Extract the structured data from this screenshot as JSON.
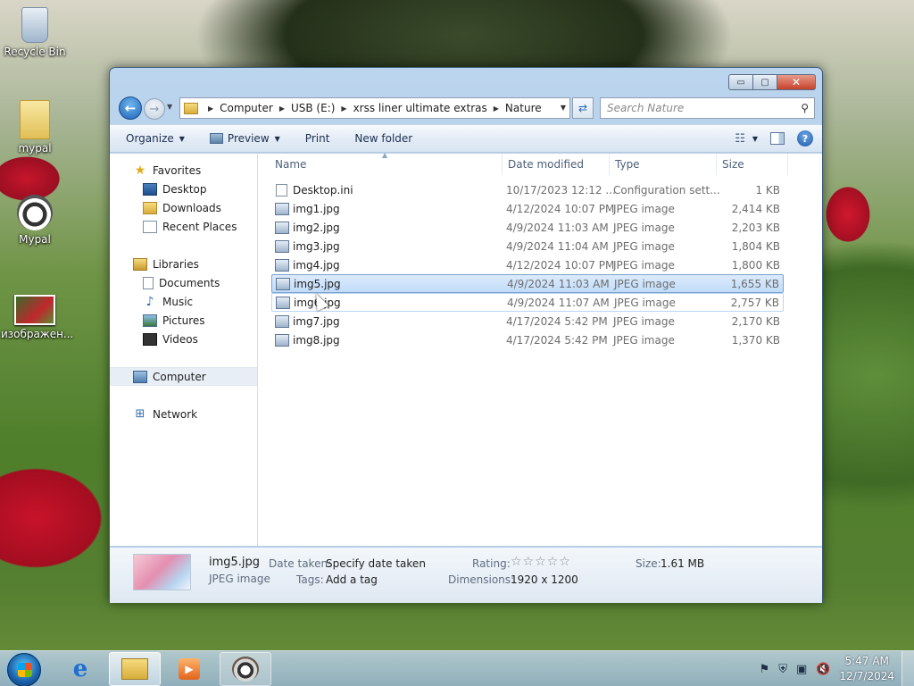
{
  "desktop": {
    "icons": [
      {
        "label": "Recycle Bin"
      },
      {
        "label": "mypal"
      },
      {
        "label": "Mypal"
      },
      {
        "label": "изображен..."
      }
    ]
  },
  "window": {
    "controls": {
      "minimize": "▭",
      "maximize": "▢",
      "close": "✕"
    },
    "address": {
      "crumbs": [
        "Computer",
        "USB (E:)",
        "xrss liner ultimate extras",
        "Nature"
      ]
    },
    "search": {
      "placeholder": "Search Nature"
    },
    "toolbar": {
      "organize": "Organize",
      "preview": "Preview",
      "print": "Print",
      "new_folder": "New folder"
    },
    "nav": {
      "favorites": "Favorites",
      "desktop": "Desktop",
      "downloads": "Downloads",
      "recent": "Recent Places",
      "libraries": "Libraries",
      "documents": "Documents",
      "music": "Music",
      "pictures": "Pictures",
      "videos": "Videos",
      "computer": "Computer",
      "network": "Network"
    },
    "columns": {
      "name": "Name",
      "date": "Date modified",
      "type": "Type",
      "size": "Size"
    },
    "files": [
      {
        "name": "Desktop.ini",
        "date": "10/17/2023 12:12 ...",
        "type": "Configuration sett...",
        "size": "1 KB"
      },
      {
        "name": "img1.jpg",
        "date": "4/12/2024 10:07 PM",
        "type": "JPEG image",
        "size": "2,414 KB"
      },
      {
        "name": "img2.jpg",
        "date": "4/9/2024 11:03 AM",
        "type": "JPEG image",
        "size": "2,203 KB"
      },
      {
        "name": "img3.jpg",
        "date": "4/9/2024 11:04 AM",
        "type": "JPEG image",
        "size": "1,804 KB"
      },
      {
        "name": "img4.jpg",
        "date": "4/12/2024 10:07 PM",
        "type": "JPEG image",
        "size": "1,800 KB"
      },
      {
        "name": "img5.jpg",
        "date": "4/9/2024 11:03 AM",
        "type": "JPEG image",
        "size": "1,655 KB"
      },
      {
        "name": "img6.jpg",
        "date": "4/9/2024 11:07 AM",
        "type": "JPEG image",
        "size": "2,757 KB"
      },
      {
        "name": "img7.jpg",
        "date": "4/17/2024 5:42 PM",
        "type": "JPEG image",
        "size": "2,170 KB"
      },
      {
        "name": "img8.jpg",
        "date": "4/17/2024 5:42 PM",
        "type": "JPEG image",
        "size": "1,370 KB"
      }
    ],
    "details": {
      "filename": "img5.jpg",
      "filetype": "JPEG image",
      "date_taken_label": "Date taken:",
      "date_taken_value": "Specify date taken",
      "tags_label": "Tags:",
      "tags_value": "Add a tag",
      "rating_label": "Rating:",
      "rating_value": 0,
      "rating_stars": "☆☆☆☆☆",
      "dimensions_label": "Dimensions:",
      "dimensions_value": "1920 x 1200",
      "size_label": "Size:",
      "size_value": "1.61 MB"
    }
  },
  "taskbar": {
    "time": "5:47 AM",
    "date": "12/7/2024"
  }
}
